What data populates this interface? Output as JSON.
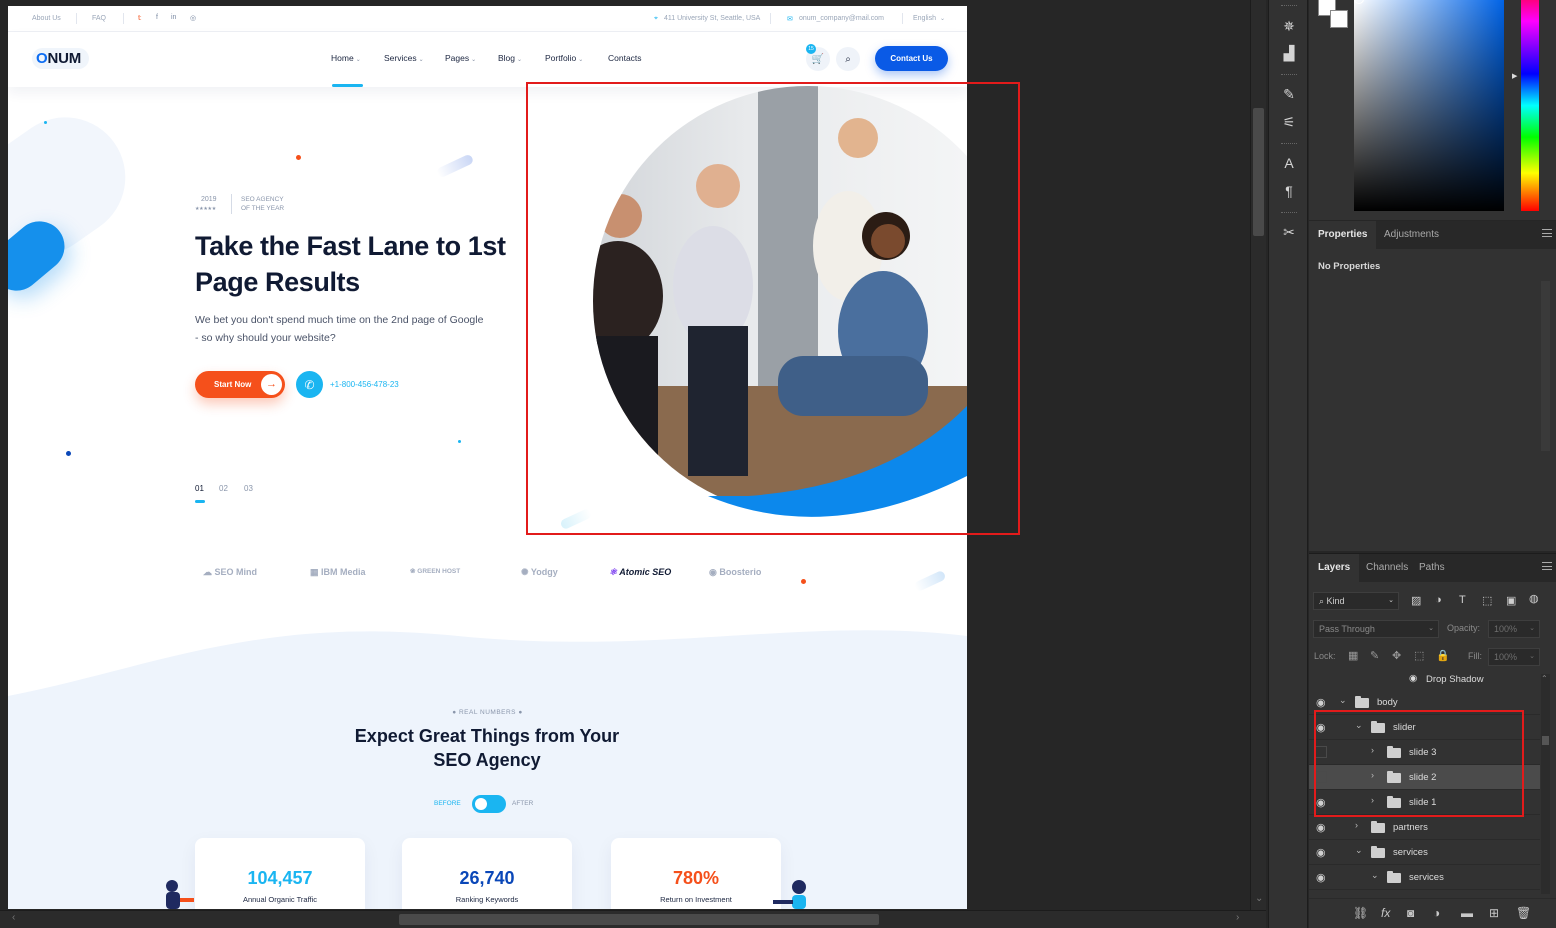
{
  "website": {
    "topbar": {
      "about_us": "About Us",
      "faq": "FAQ",
      "social": [
        "𝕥",
        "f",
        "in",
        "◎"
      ],
      "address": "411 University St, Seattle, USA",
      "email": "onum_company@mail.com",
      "language": "English"
    },
    "nav": {
      "logo": "NUM",
      "logo_o": "O",
      "menu": [
        "Home",
        "Services",
        "Pages",
        "Blog",
        "Portfolio",
        "Contacts"
      ],
      "cart_badge": "15",
      "contact_button": "Contact Us"
    },
    "hero": {
      "award_year": "2019",
      "award_stars": "★★★★★",
      "award_line1": "SEO AGENCY",
      "award_line2": "OF THE YEAR",
      "title": "Take the Fast Lane to 1st Page Results",
      "subtitle": "We bet you don't spend much time on the 2nd page of Google - so why should your website?",
      "start_button": "Start Now",
      "phone": "+1-800-456-478-23",
      "slides": [
        "01",
        "02",
        "03"
      ]
    },
    "partners": [
      "SEO Mind",
      "IBM Media",
      "GREEN HOST",
      "Yodgy",
      "Atomic SEO",
      "Boosterio"
    ],
    "numbers": {
      "kicker": "REAL NUMBERS",
      "title": "Expect Great Things from Your SEO Agency",
      "before": "BEFORE",
      "after": "AFTER",
      "cards": [
        {
          "value": "104,457",
          "label": "Annual Organic Traffic",
          "color": "#1ab5f1"
        },
        {
          "value": "26,740",
          "label": "Ranking Keywords",
          "color": "#0a47b8"
        },
        {
          "value": "780%",
          "label": "Return on Investment",
          "color": "#f5501b"
        }
      ]
    }
  },
  "photoshop": {
    "properties_tab": "Properties",
    "adjustments_tab": "Adjustments",
    "no_properties": "No Properties",
    "layers_tab": "Layers",
    "channels_tab": "Channels",
    "paths_tab": "Paths",
    "kind": "Kind",
    "blend_mode": "Pass Through",
    "opacity_label": "Opacity:",
    "opacity_value": "100%",
    "lock_label": "Lock:",
    "fill_label": "Fill:",
    "fill_value": "100%",
    "effect_row": "Drop Shadow",
    "layers": [
      {
        "name": "body",
        "indent": 0,
        "visible": true,
        "expanded": true,
        "selected": false
      },
      {
        "name": "slider",
        "indent": 1,
        "visible": true,
        "expanded": true,
        "selected": false
      },
      {
        "name": "slide 3",
        "indent": 2,
        "visible": false,
        "expanded": false,
        "selected": false
      },
      {
        "name": "slide 2",
        "indent": 2,
        "visible": false,
        "expanded": false,
        "selected": true
      },
      {
        "name": "slide 1",
        "indent": 2,
        "visible": true,
        "expanded": false,
        "selected": false
      },
      {
        "name": "partners",
        "indent": 1,
        "visible": true,
        "expanded": false,
        "selected": false
      },
      {
        "name": "services",
        "indent": 1,
        "visible": true,
        "expanded": true,
        "selected": false
      },
      {
        "name": "services",
        "indent": 2,
        "visible": true,
        "expanded": true,
        "selected": false
      }
    ],
    "tool_icons": [
      "3d-icon",
      "histogram-icon",
      "brush-presets-icon",
      "adjust-icon",
      "character-icon",
      "paragraph-icon",
      "tool-presets-icon"
    ]
  }
}
